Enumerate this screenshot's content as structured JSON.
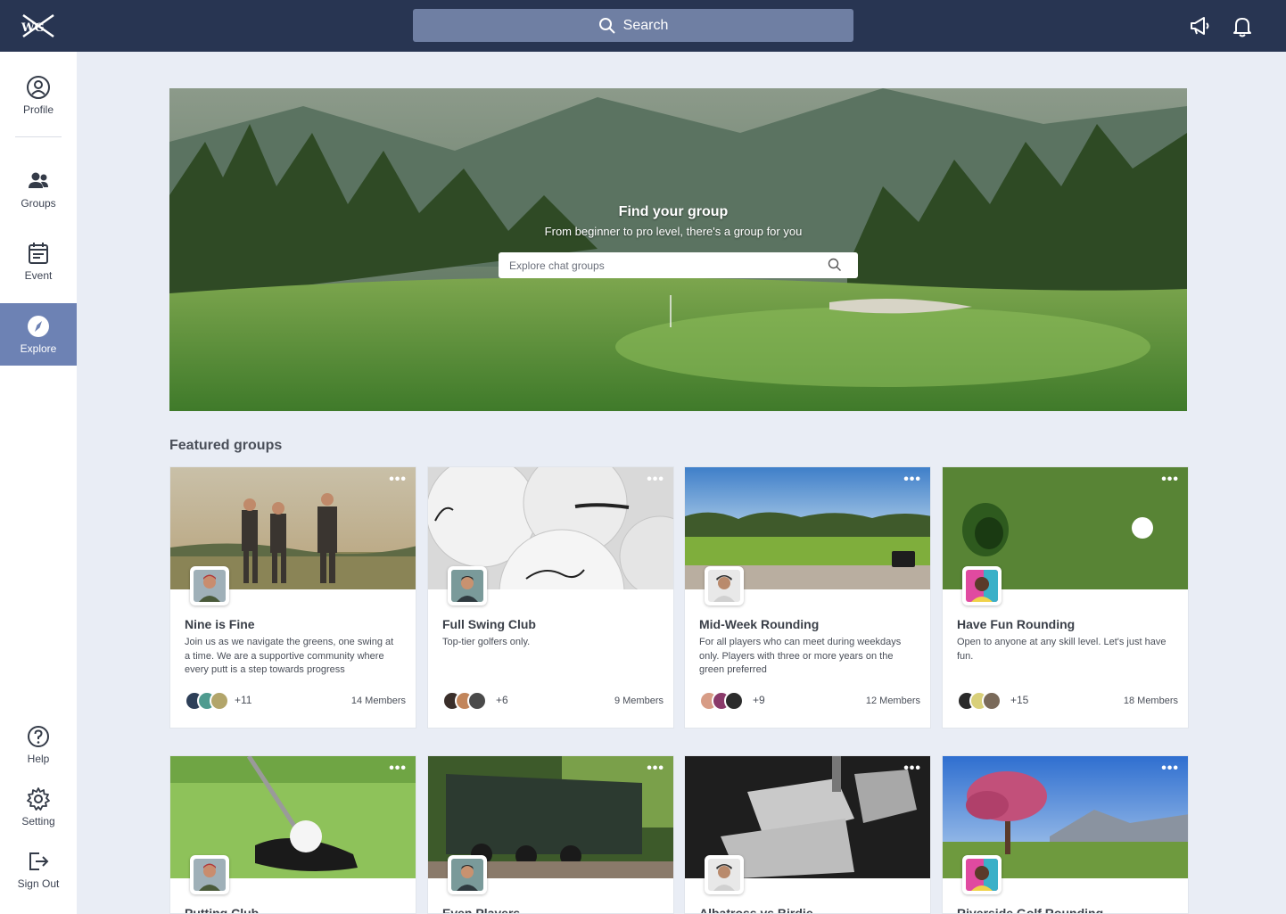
{
  "brand": {
    "logo_text": "WG"
  },
  "topbar": {
    "search_label": "Search"
  },
  "sidebar": {
    "items": [
      {
        "label": "Profile",
        "icon": "user-circle-icon"
      },
      {
        "label": "Groups",
        "icon": "users-icon"
      },
      {
        "label": "Event",
        "icon": "calendar-icon"
      },
      {
        "label": "Explore",
        "icon": "compass-icon",
        "active": true
      }
    ],
    "bottom": [
      {
        "label": "Help",
        "icon": "help-icon"
      },
      {
        "label": "Setting",
        "icon": "gear-icon"
      },
      {
        "label": "Sign Out",
        "icon": "sign-out-icon"
      }
    ]
  },
  "hero": {
    "title": "Find your group",
    "subtitle": "From beginner to pro level, there's a group for you",
    "search_placeholder": "Explore chat groups"
  },
  "featured": {
    "title": "Featured groups",
    "groups": [
      {
        "name": "Nine is Fine",
        "description": "Join us as we navigate the greens, one swing at a time. We are a supportive community where every putt is a step towards progress",
        "extra": "+11",
        "members": "14 Members"
      },
      {
        "name": "Full Swing Club",
        "description": "Top-tier golfers only.",
        "extra": "+6",
        "members": "9 Members"
      },
      {
        "name": "Mid-Week Rounding",
        "description": "For all players who can meet during weekdays only. Players with three or more years on the green preferred",
        "extra": "+9",
        "members": "12 Members"
      },
      {
        "name": "Have Fun Rounding",
        "description": "Open to anyone at any skill level. Let's just have fun.",
        "extra": "+15",
        "members": "18 Members"
      },
      {
        "name": "Putting Club"
      },
      {
        "name": "Even Players"
      },
      {
        "name": "Albatross vs Birdie"
      },
      {
        "name": "Riverside Golf Rounding"
      }
    ]
  },
  "colors": {
    "topbar": "#283552",
    "active": "#6d82b4",
    "search": "#6f7fa3"
  }
}
